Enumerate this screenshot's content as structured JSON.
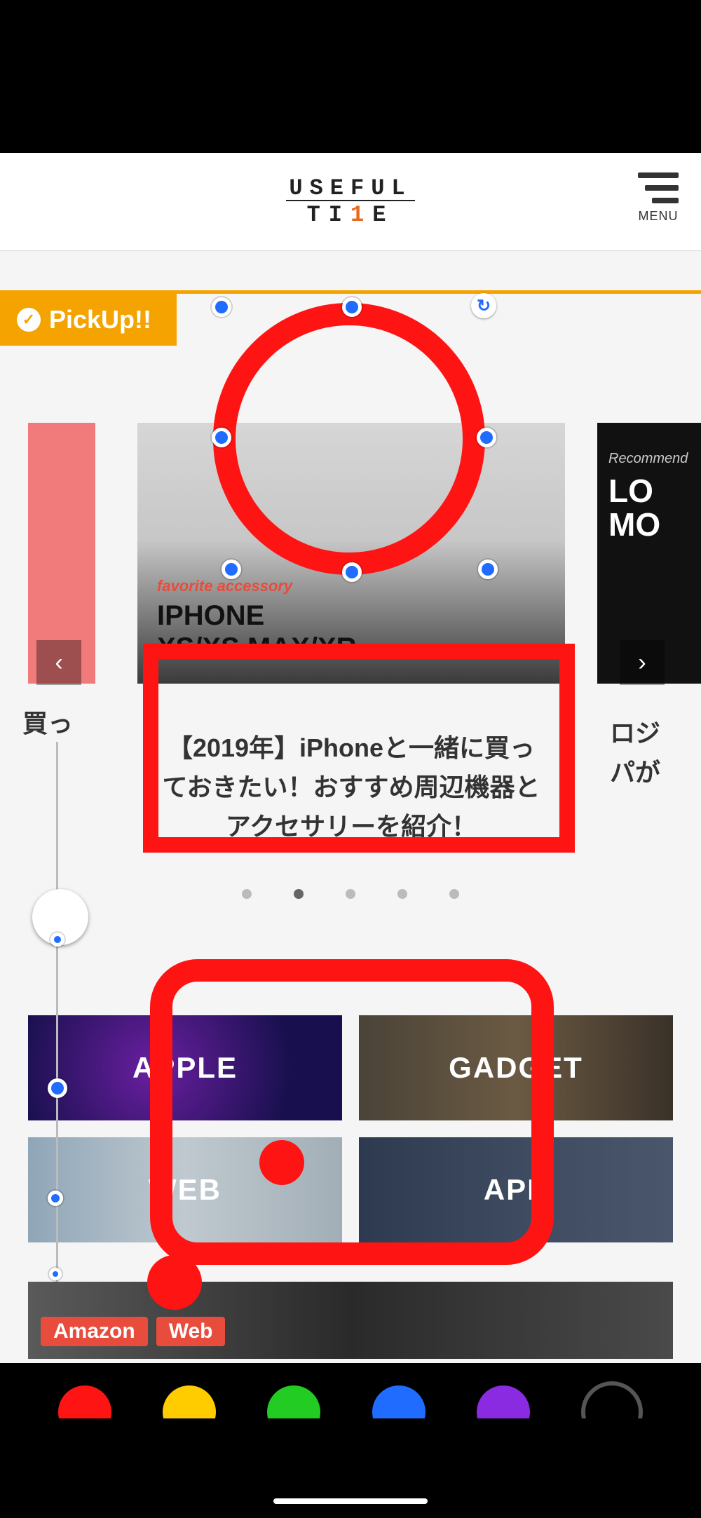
{
  "header": {
    "logo_top": "USEFUL",
    "logo_bot_pre": "TI",
    "logo_bot_accent": "1",
    "logo_bot_post": "E",
    "menu_label": "MENU"
  },
  "pickup": {
    "label": "PickUp!!"
  },
  "carousel": {
    "left_caption_fragment": "買っ",
    "main": {
      "subtitle": "favorite accessory",
      "title_line1": "IPHONE",
      "title_line2": "XS/XS MAX/XR",
      "caption": "【2019年】iPhoneと一緒に買っておきたい！おすすめ周辺機器とアクセサリーを紹介！"
    },
    "right": {
      "subtitle": "Recommend",
      "title_line1": "LO",
      "title_line2": "MO",
      "caption_fragment_line1": "ロジ",
      "caption_fragment_line2": "パが"
    },
    "active_index": 1,
    "total_dots": 5
  },
  "categories": {
    "tiles": [
      {
        "label": "APPLE"
      },
      {
        "label": "GADGET"
      },
      {
        "label": "WEB"
      },
      {
        "label": "APP"
      }
    ]
  },
  "bottom_tags": {
    "tag1": "Amazon",
    "tag2": "Web"
  },
  "palette": {
    "colors": [
      {
        "name": "red",
        "hex": "#ff1414",
        "selected": true
      },
      {
        "name": "yellow",
        "hex": "#ffcc00",
        "selected": false
      },
      {
        "name": "green",
        "hex": "#22cc22",
        "selected": false
      },
      {
        "name": "blue",
        "hex": "#1f6cff",
        "selected": false
      },
      {
        "name": "purple",
        "hex": "#8a2be2",
        "selected": false
      },
      {
        "name": "black",
        "hex": "#000000",
        "selected": false
      }
    ]
  },
  "markup": {
    "ring_circle": {
      "shape": "circle",
      "stroke": "#ff1414"
    },
    "caption_box": {
      "shape": "rect",
      "stroke": "#ff1414"
    },
    "category_box": {
      "shape": "round-rect",
      "stroke": "#ff1414"
    }
  }
}
